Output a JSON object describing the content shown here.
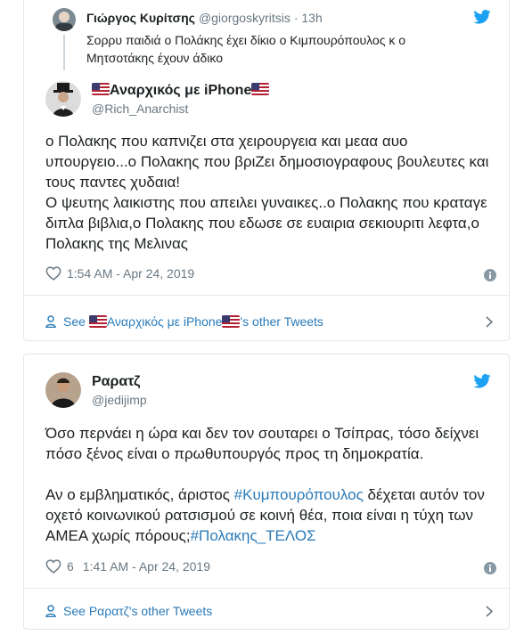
{
  "card1": {
    "parent": {
      "name": "Γιώργος Κυρίτσης",
      "handle": "@giorgoskyritsis",
      "time": "· 13h",
      "text": "Σορρυ παιδιά ο Πολάκης έχει δίκιο ο Κιμπουρόπουλος κ ο Μητσοτάκης έχουν άδικο"
    },
    "author": {
      "name": "Αναρχικός με iPhone",
      "handle": "@Rich_Anarchist"
    },
    "text_lines": [
      "ο Πολακης που καπνιζει στα χειρουργεια και μεαα αυο υπουργειο...ο Πολακης που βριΖει δημοσιογραφους βουλευτες και τους παντες χυδαια!",
      "Ο ψευτης λαικιστης που απειλει γυναικες..ο Πολακης που κραταγε διπλα βιβλια,ο Πολακης που εδωσε σε ευαιρια σεκιουριτι λεφτα,ο Πολακης της Μελινας"
    ],
    "likes": "",
    "timestamp": "1:54 AM - Apr 24, 2019",
    "see_more": {
      "prefix": "See ",
      "name": "Αναρχικός με iPhone",
      "suffix": "'s other Tweets"
    }
  },
  "card2": {
    "author": {
      "name": "Ραρατζ",
      "handle": "@jedijimp"
    },
    "para1": "Όσο περνάει η ώρα και δεν τον σουταρει ο Τσίπρας, τόσο δείχνει πόσο ξένος είναι ο πρωθυπουργός προς τη δημοκρατία.",
    "para2_a": "Αν ο εμβληματικός, άριστος ",
    "hashtag1": "#Κυμπουρόπουλος",
    "para2_b": " δέχεται αυτόν τον οχετό κοινωνικού ρατσισμού σε κοινή θέα, ποια είναι η τύχη των ΑΜΕΑ χωρίς πόρους;",
    "hashtag2": "#Πολακης_ΤΕΛΟΣ",
    "likes": "6",
    "timestamp": "1:41 AM - Apr 24, 2019",
    "see_more": {
      "prefix": "See ",
      "name": "Ραρατζ",
      "suffix": "'s other Tweets"
    }
  },
  "icons": {
    "bird": "twitter-bird-icon",
    "heart": "heart-icon",
    "info": "info-icon",
    "person": "person-icon",
    "chevron": "chevron-right-icon",
    "flag": "us-flag-icon"
  },
  "colors": {
    "link": "#2b7bb9",
    "text": "#1c2022",
    "muted": "#697882",
    "border": "#e1e8ed",
    "bird": "#1da1f2"
  }
}
